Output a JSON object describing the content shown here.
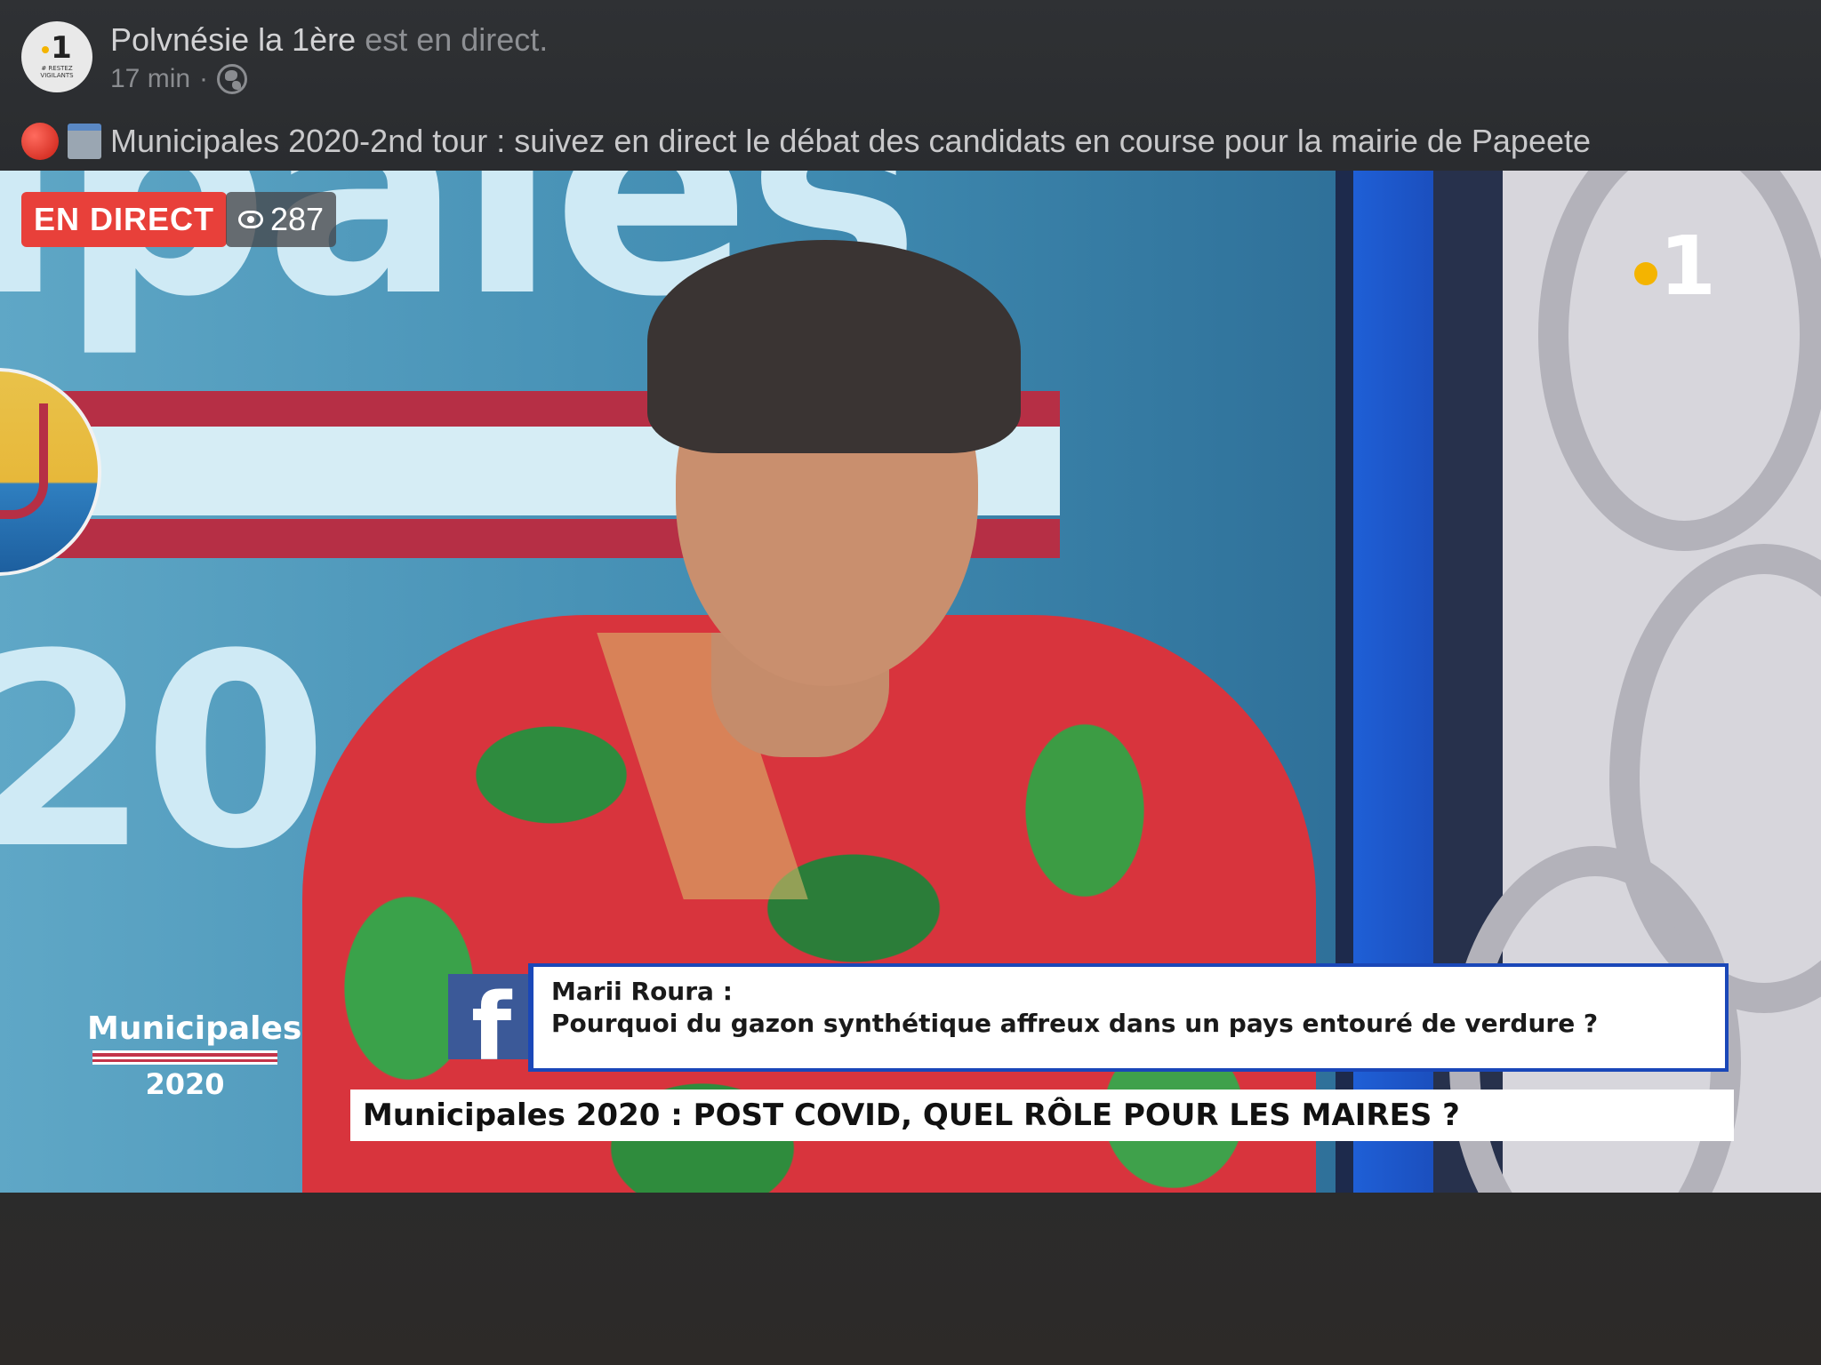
{
  "post": {
    "page_name": "Polvnésie la 1ère",
    "live_suffix": "est en direct.",
    "time": "17 min",
    "separator": "·",
    "privacy_icon": "globe-icon",
    "text": "Municipales 2020-2nd tour : suivez en direct le débat des candidats en course pour la mairie de Papeete",
    "avatar": {
      "number": "1",
      "caption": "# RESTEZ VIGILANTS"
    }
  },
  "video": {
    "live_label": "EN DIRECT",
    "viewer_count": "287",
    "background_word": "ipales",
    "background_year": "20",
    "channel_logo": "1",
    "show_logo": {
      "name": "Municipales",
      "year": "2020"
    },
    "comment": {
      "author": "Marii Roura :",
      "text": "Pourquoi du gazon synthétique affreux dans un pays entouré de verdure ?"
    },
    "banner": "Municipales 2020 : POST COVID, QUEL RÔLE POUR LES MAIRES ?"
  },
  "colors": {
    "live_red": "#e8403a",
    "facebook_blue": "#3b5998",
    "accent_yellow": "#f4b400"
  }
}
